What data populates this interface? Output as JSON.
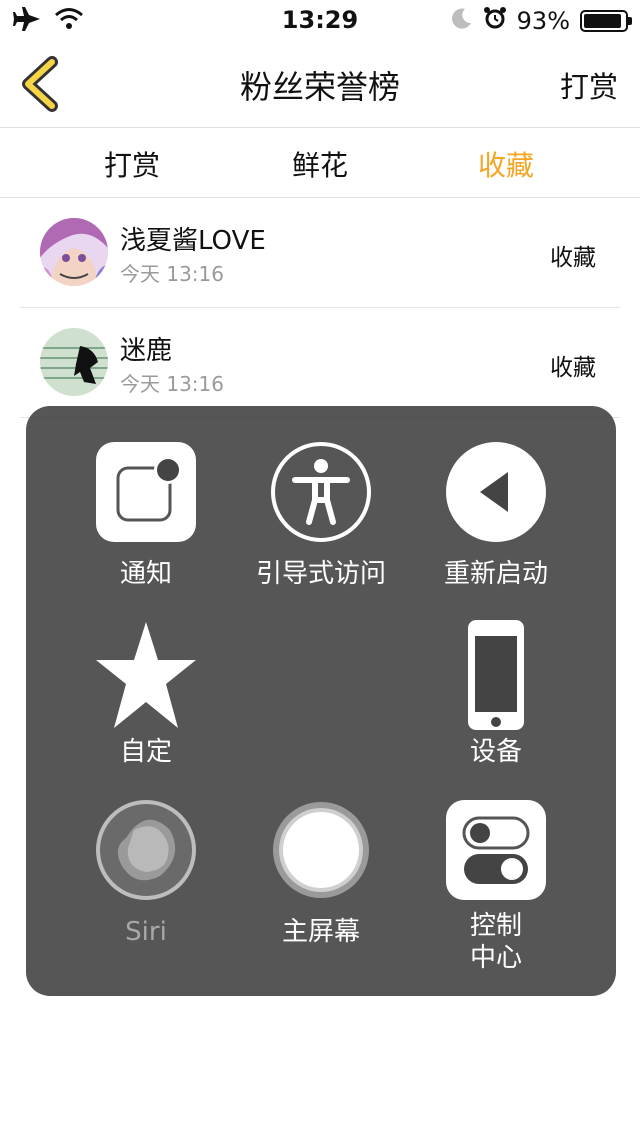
{
  "status_bar": {
    "time": "13:29",
    "battery": "93%",
    "battery_level": 0.93
  },
  "nav": {
    "title": "粉丝荣誉榜",
    "right": "打赏"
  },
  "tabs": [
    {
      "label": "打赏",
      "active": false
    },
    {
      "label": "鲜花",
      "active": false
    },
    {
      "label": "收藏",
      "active": true
    }
  ],
  "list": [
    {
      "name": "浅夏酱LOVE",
      "time": "今天 13:16",
      "action": "收藏"
    },
    {
      "name": "迷鹿",
      "time": "今天 13:16",
      "action": "收藏"
    }
  ],
  "assistive_menu": {
    "notification": "通知",
    "guided_access": "引导式访问",
    "restart": "重新启动",
    "custom": "自定",
    "device": "设备",
    "siri": "Siri",
    "home": "主屏幕",
    "control_center": "控制\n中心"
  },
  "colors": {
    "accent": "#f5a623",
    "overlay": "#3a3a3a",
    "back_icon": "#f5d547"
  }
}
